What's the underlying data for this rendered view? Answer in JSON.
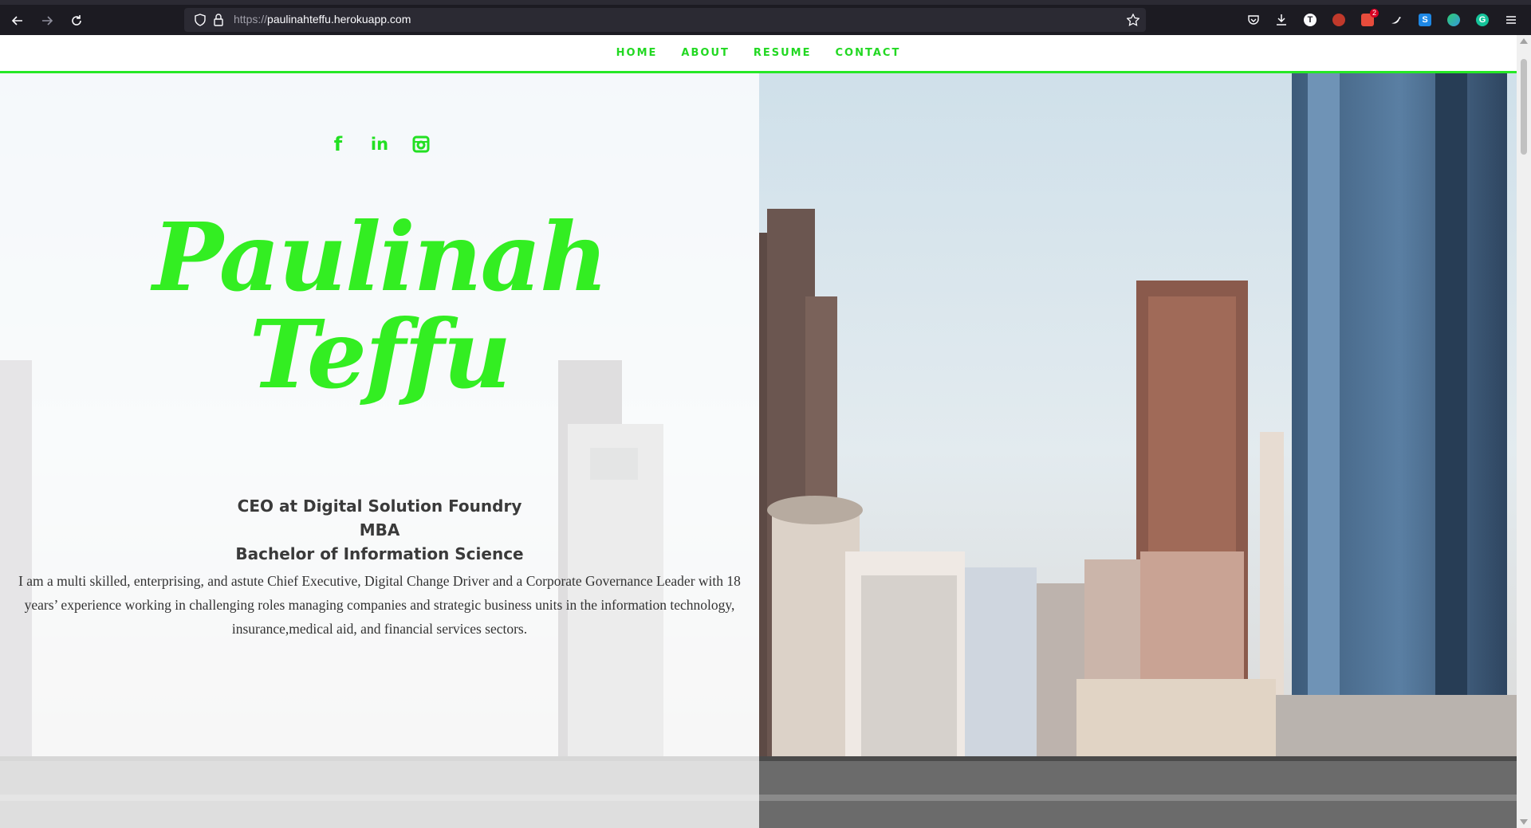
{
  "browser": {
    "url_protocol": "https://",
    "url_host": "paulinahteffu.herokuapp.com",
    "extension_badge_count": "2"
  },
  "nav": {
    "items": [
      "HOME",
      "ABOUT",
      "RESUME",
      "CONTACT"
    ],
    "accent_color": "#22d822"
  },
  "social": [
    "facebook-icon",
    "linkedin-icon",
    "instagram-icon"
  ],
  "hero": {
    "name_line1": "Paulinah",
    "name_line2": "Teffu",
    "title1": "CEO at Digital Solution Foundry",
    "title2": "MBA",
    "title3": "Bachelor of Information Science",
    "bio": "I am a multi skilled, enterprising, and astute Chief Executive, Digital Change Driver and a Corporate Governance Leader with 18 years’ experience working in challenging roles managing companies and strategic business units in the information technology, insurance,medical aid, and financial services sectors."
  }
}
